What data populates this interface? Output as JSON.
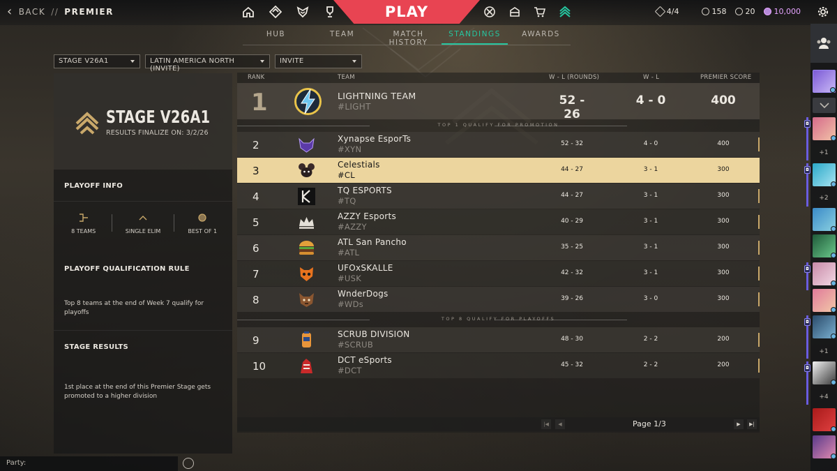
{
  "header": {
    "back_label": "BACK",
    "separator": "//",
    "breadcrumb": "PREMIER",
    "play_label": "PLAY",
    "nav_left_icons": [
      "home-icon",
      "agents-icon",
      "premier-icon",
      "trophy-icon"
    ],
    "nav_right_icons": [
      "battlepass-icon",
      "collection-icon",
      "store-icon",
      "premier-rank-icon"
    ],
    "level": "4/4",
    "valorant_points": "158",
    "radianite_points": "20",
    "kingdom_credits": "10,000"
  },
  "tabs": [
    {
      "label": "HUB",
      "active": false
    },
    {
      "label": "TEAM",
      "active": false
    },
    {
      "label": "MATCH HISTORY",
      "active": false
    },
    {
      "label": "STANDINGS",
      "active": true
    },
    {
      "label": "AWARDS",
      "active": false
    }
  ],
  "filters": {
    "stage": "STAGE V26A1",
    "region": "LATIN AMERICA NORTH (INVITE)",
    "division": "INVITE"
  },
  "stage": {
    "title": "STAGE V26A1",
    "finalize": "RESULTS FINALIZE ON: 3/2/26"
  },
  "playoff": {
    "info_heading": "PLAYOFF INFO",
    "teams": "8 TEAMS",
    "format": "SINGLE ELIM",
    "series": "BEST OF 1",
    "rule_heading": "PLAYOFF QUALIFICATION RULE",
    "rule_text": "Top 8 teams at the end of Week 7 qualify for playoffs",
    "results_heading": "STAGE RESULTS",
    "results_text": "1st place at the end of this Premier Stage gets promoted to a higher division"
  },
  "table": {
    "columns": {
      "rank": "RANK",
      "team": "TEAM",
      "rounds": "W - L (ROUNDS)",
      "wl": "W - L",
      "score": "PREMIER SCORE"
    },
    "promo_divider": "TOP 1 QUALIFY FOR PROMOTION",
    "playoff_divider": "TOP 8 QUALIFY FOR PLAYOFFS",
    "rows": [
      {
        "rank": "1",
        "name": "LIGHTNING TEAM",
        "tag": "#LIGHT",
        "rounds": "52 - 26",
        "wl": "4 - 0",
        "score": "400"
      },
      {
        "rank": "2",
        "name": "Xynapse EsporTs",
        "tag": "#XYN",
        "rounds": "52 - 32",
        "wl": "4 - 0",
        "score": "400"
      },
      {
        "rank": "3",
        "name": "Celestials",
        "tag": "#CL",
        "rounds": "44 - 27",
        "wl": "3 - 1",
        "score": "300"
      },
      {
        "rank": "4",
        "name": "TQ ESPORTS",
        "tag": "#TQ",
        "rounds": "44 - 27",
        "wl": "3 - 1",
        "score": "300"
      },
      {
        "rank": "5",
        "name": "AZZY Esports",
        "tag": "#AZZY",
        "rounds": "40 - 29",
        "wl": "3 - 1",
        "score": "300"
      },
      {
        "rank": "6",
        "name": "ATL San Pancho",
        "tag": "#ATL",
        "rounds": "35 - 25",
        "wl": "3 - 1",
        "score": "300"
      },
      {
        "rank": "7",
        "name": "UFOxSKALLE",
        "tag": "#USK",
        "rounds": "42 - 32",
        "wl": "3 - 1",
        "score": "300"
      },
      {
        "rank": "8",
        "name": "WnderDogs",
        "tag": "#WDs",
        "rounds": "39 - 26",
        "wl": "3 - 0",
        "score": "300"
      },
      {
        "rank": "9",
        "name": "SCRUB DIVISION",
        "tag": "#SCRUB",
        "rounds": "48 - 30",
        "wl": "2 - 2",
        "score": "200"
      },
      {
        "rank": "10",
        "name": "DCT eSports",
        "tag": "#DCT",
        "rounds": "45 - 32",
        "wl": "2 - 2",
        "score": "200"
      }
    ]
  },
  "pager": {
    "label": "Page 1/3"
  },
  "social": {
    "friends_icon": "friends-icon",
    "group_counts": [
      "+1",
      "+2",
      "+1",
      "+4"
    ]
  },
  "party": {
    "placeholder": "Party:"
  },
  "colors": {
    "accent": "#26c6a0",
    "play_red": "#e84452",
    "highlight_row": "#ecd59e",
    "kingdom_credit": "#e6a4ff"
  }
}
